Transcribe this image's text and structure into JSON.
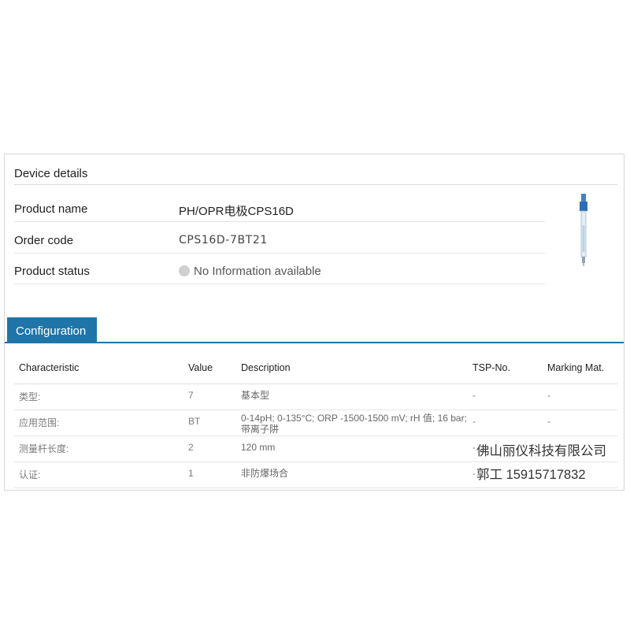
{
  "details": {
    "title": "Device details",
    "rows": [
      {
        "label": "Product name",
        "value": "PH/OPR电极CPS16D"
      },
      {
        "label": "Order code",
        "value": "CPS16D-7BT21"
      },
      {
        "label": "Product status",
        "value": "No Information available"
      }
    ],
    "product_image_icon": "ph-electrode-probe-icon"
  },
  "tab": {
    "label": "Configuration"
  },
  "table": {
    "headers": [
      "Characteristic",
      "Value",
      "Description",
      "TSP-No.",
      "Marking Mat."
    ],
    "rows": [
      [
        "类型:",
        "7",
        "基本型",
        "-",
        "-"
      ],
      [
        "应用范围:",
        "BT",
        "0-14pH; 0-135°C; ORP -1500-1500 mV; rH 值; 16 bar; 带离子阱",
        "-",
        "-"
      ],
      [
        "测量杆长度:",
        "2",
        "120 mm",
        "-",
        ""
      ],
      [
        "认证:",
        "1",
        "非防爆场合",
        "-",
        ""
      ]
    ]
  },
  "watermark": {
    "company": "佛山丽仪科技有限公司",
    "contact": "郭工 15915717832"
  },
  "colors": {
    "accent": "#1f75a8",
    "status_dot": "#cfcfcf"
  }
}
